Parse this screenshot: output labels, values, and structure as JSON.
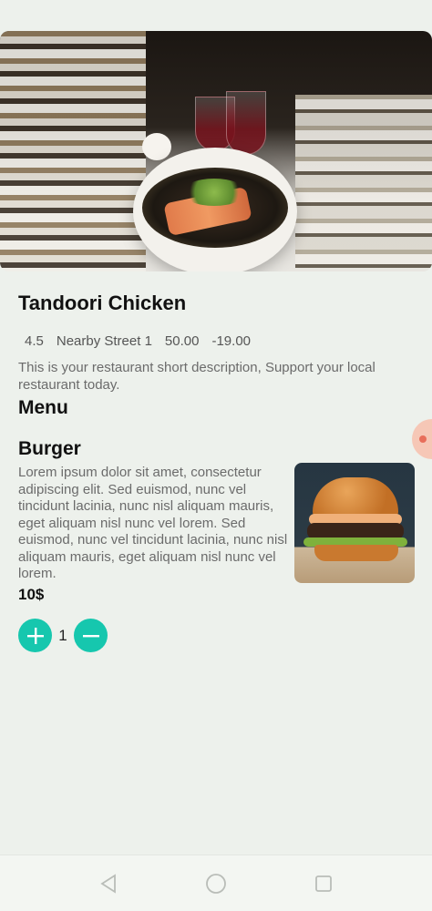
{
  "restaurant": {
    "name": "Tandoori Chicken",
    "rating": "4.5",
    "address": "Nearby Street 1",
    "value1": "50.00",
    "value2": "-19.00",
    "description": "This is your restaurant short description, Support your local restaurant today."
  },
  "menu": {
    "heading": "Menu",
    "items": [
      {
        "name": "Burger",
        "description": "Lorem ipsum dolor sit amet, consectetur adipiscing elit. Sed euismod, nunc vel tincidunt lacinia, nunc nisl aliquam mauris, eget aliquam nisl nunc vel lorem. Sed euismod, nunc vel tincidunt lacinia, nunc nisl aliquam mauris, eget aliquam nisl nunc vel lorem.",
        "price": "10$",
        "quantity": "1"
      }
    ]
  },
  "icons": {
    "increment": "plus-icon",
    "decrement": "minus-icon",
    "nav_back": "triangle-back-icon",
    "nav_home": "circle-home-icon",
    "nav_recents": "square-recents-icon"
  },
  "colors": {
    "accent": "#16c7ae",
    "background": "#edf1ec",
    "fab": "#f6c7b6"
  }
}
